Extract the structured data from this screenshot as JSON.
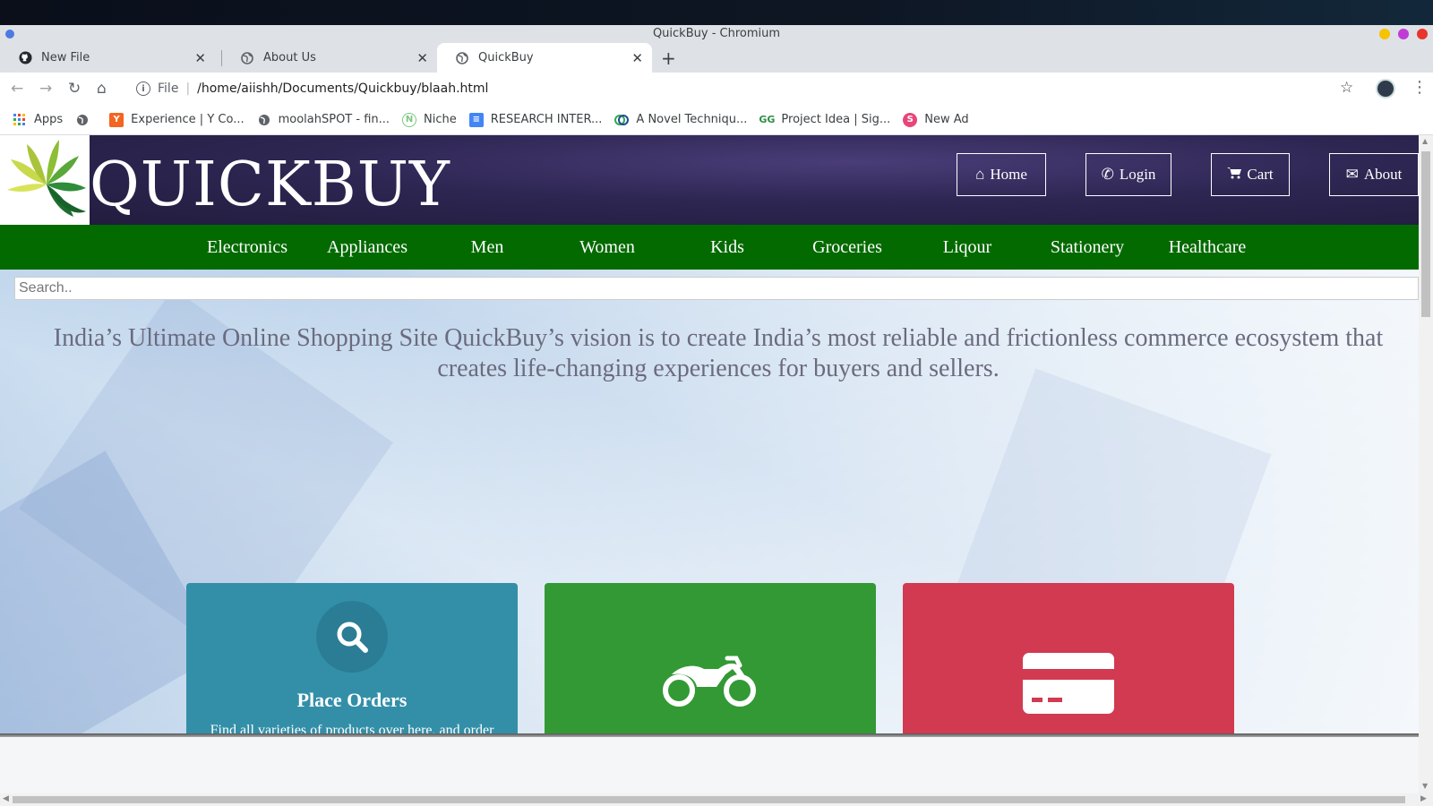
{
  "window": {
    "title": "QuickBuy - Chromium"
  },
  "tabs": [
    {
      "label": "New File",
      "icon": "github-icon"
    },
    {
      "label": "About Us",
      "icon": "globe-icon"
    },
    {
      "label": "QuickBuy",
      "icon": "globe-icon",
      "active": true
    }
  ],
  "omnibox": {
    "scheme_label": "File",
    "url": "/home/aiishh/Documents/Quickbuy/blaah.html"
  },
  "bookmarks": [
    {
      "label": "Apps",
      "icon": "apps-grid-icon"
    },
    {
      "label": "",
      "icon": "globe-icon"
    },
    {
      "label": "Experience | Y Co...",
      "icon": "ycombinator-icon",
      "color": "#f26522"
    },
    {
      "label": "moolahSPOT - fin...",
      "icon": "globe-icon"
    },
    {
      "label": "Niche",
      "icon": "niche-icon",
      "color": "#7bc67e"
    },
    {
      "label": "RESEARCH INTER...",
      "icon": "docs-icon",
      "color": "#4285f4"
    },
    {
      "label": "A Novel Techniqu...",
      "icon": "research-icon"
    },
    {
      "label": "Project Idea | Sig...",
      "icon": "gfg-icon",
      "color": "#2f8d46"
    },
    {
      "label": "New Ad",
      "icon": "ad-icon",
      "color": "#e8457a"
    }
  ],
  "site": {
    "brand": "QUICKBUY",
    "header_buttons": [
      {
        "label": "Home",
        "icon": "home-icon",
        "glyph": "⌂"
      },
      {
        "label": "Login",
        "icon": "phone-icon",
        "glyph": "✆"
      },
      {
        "label": "Cart",
        "icon": "cart-icon",
        "glyph": "🛒"
      },
      {
        "label": "About",
        "icon": "envelope-icon",
        "glyph": "✉"
      }
    ],
    "nav": [
      "Electronics",
      "Appliances",
      "Men",
      "Women",
      "Kids",
      "Groceries",
      "Liqour",
      "Stationery",
      "Healthcare"
    ],
    "search_placeholder": "Search..",
    "tagline": "India’s Ultimate Online Shopping Site QuickBuy’s vision is to create India’s most reliable and frictionless commerce ecosystem that creates life-changing experiences for buyers and sellers.",
    "cards": [
      {
        "title": "Place Orders",
        "desc": "Find all varieties of products over here, and order them all in just one click.",
        "icon": "search-icon",
        "color": "#338fa8"
      },
      {
        "title": "",
        "desc": "",
        "icon": "motorcycle-icon",
        "color": "#339935"
      },
      {
        "title": "",
        "desc": "",
        "icon": "credit-card-icon",
        "color": "#d13a50"
      }
    ]
  }
}
